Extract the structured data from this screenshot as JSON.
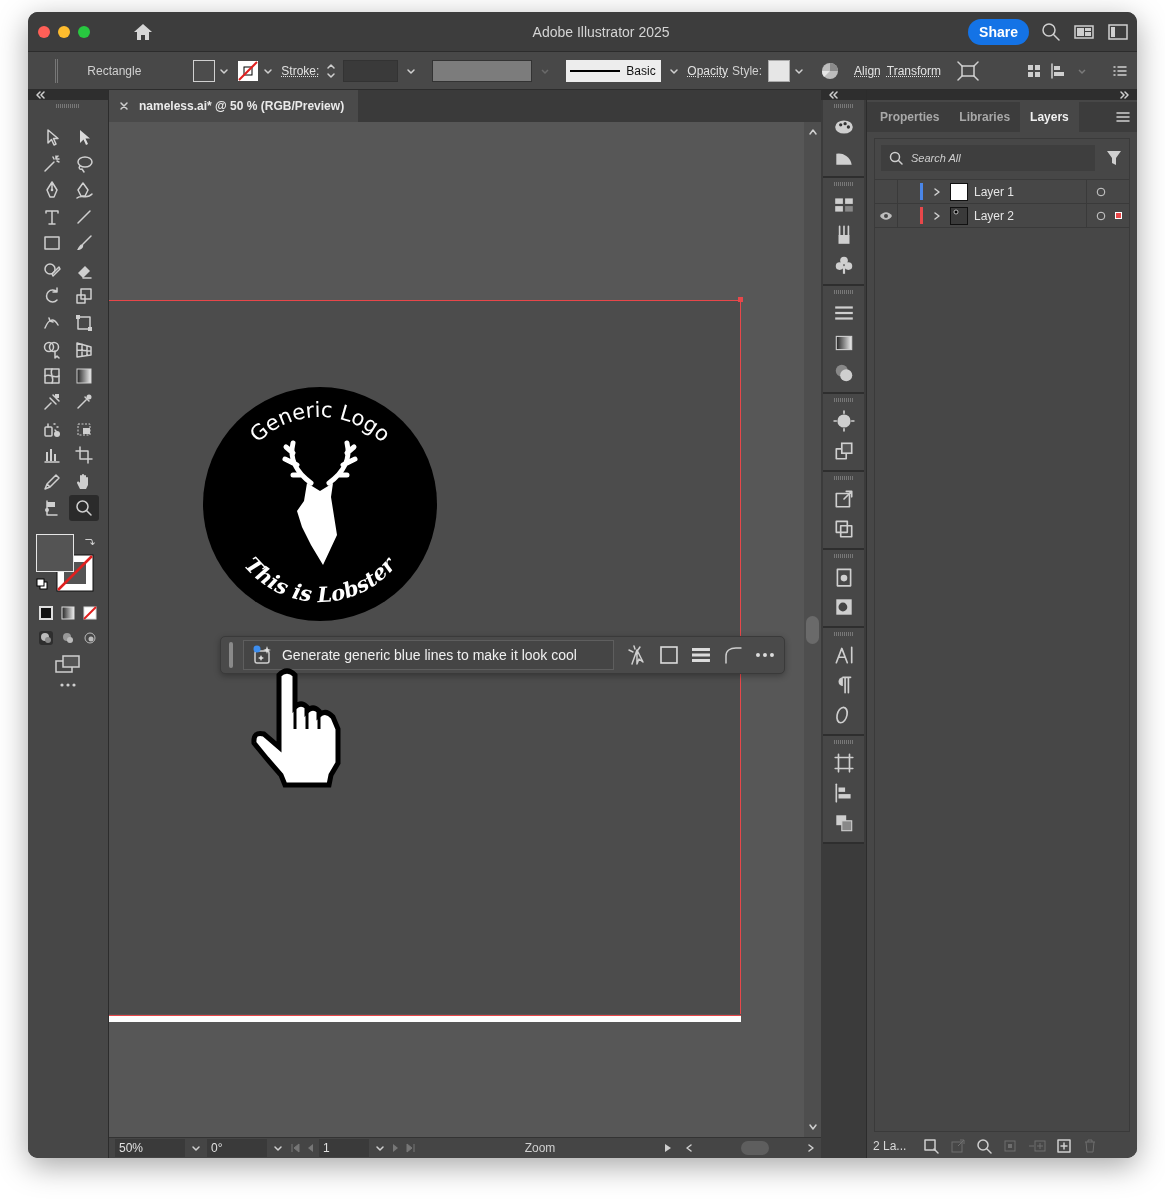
{
  "window": {
    "title": "Adobe Illustrator 2025",
    "share_button": "Share"
  },
  "control_bar": {
    "selection": "Rectangle",
    "stroke_link": "Stroke:",
    "brush": "Basic",
    "opacity_link": "Opacity",
    "style_label": "Style:",
    "align_link": "Align",
    "transform_link": "Transform"
  },
  "tools": [
    {
      "kind": "select",
      "selected": false
    },
    {
      "kind": "direct",
      "selected": false
    },
    {
      "kind": "wand",
      "selected": false
    },
    {
      "kind": "lasso",
      "selected": false
    },
    {
      "kind": "pen",
      "selected": false
    },
    {
      "kind": "curvature",
      "selected": false
    },
    {
      "kind": "type",
      "selected": false
    },
    {
      "kind": "line",
      "selected": false
    },
    {
      "kind": "rectangle",
      "selected": false
    },
    {
      "kind": "brush",
      "selected": false
    },
    {
      "kind": "shaper",
      "selected": false
    },
    {
      "kind": "eraser",
      "selected": false
    },
    {
      "kind": "rotate",
      "selected": false
    },
    {
      "kind": "scale",
      "selected": false
    },
    {
      "kind": "width",
      "selected": false
    },
    {
      "kind": "freetransform",
      "selected": false
    },
    {
      "kind": "shapebuilder",
      "selected": false
    },
    {
      "kind": "perspective",
      "selected": false
    },
    {
      "kind": "mesh",
      "selected": false
    },
    {
      "kind": "gradient",
      "selected": false
    },
    {
      "kind": "blend",
      "selected": false
    },
    {
      "kind": "eyedropper",
      "selected": false
    },
    {
      "kind": "symbol",
      "selected": false
    },
    {
      "kind": "frame",
      "selected": false
    },
    {
      "kind": "graph",
      "selected": false
    },
    {
      "kind": "artboard",
      "selected": false
    },
    {
      "kind": "pencil",
      "selected": false
    },
    {
      "kind": "hand",
      "selected": false
    },
    {
      "kind": "puppet",
      "selected": false
    },
    {
      "kind": "zoom",
      "selected": true
    }
  ],
  "document_tab": {
    "title": "nameless.ai* @ 50 % (RGB/Preview)"
  },
  "artwork": {
    "top_text": "Generic Logo",
    "bottom_text": "This is Lobster"
  },
  "contextual_bar": {
    "prompt": "Generate generic blue lines to make it look cool"
  },
  "status_bar": {
    "zoom": "50%",
    "rotation": "0°",
    "artboard": "1",
    "tool": "Zoom"
  },
  "panel_tabs": [
    {
      "label": "Properties",
      "selected": false
    },
    {
      "label": "Libraries",
      "selected": false
    },
    {
      "label": "Layers",
      "selected": true
    }
  ],
  "layers_panel": {
    "search_placeholder": "Search All",
    "layers": [
      {
        "name": "Layer 1",
        "color": "#4a86e8",
        "visible": false,
        "kind": "blank",
        "has_selection": false
      },
      {
        "name": "Layer 2",
        "color": "#e8474a",
        "visible": true,
        "kind": "artwork",
        "has_selection": true
      }
    ],
    "footer_count": "2 La..."
  }
}
